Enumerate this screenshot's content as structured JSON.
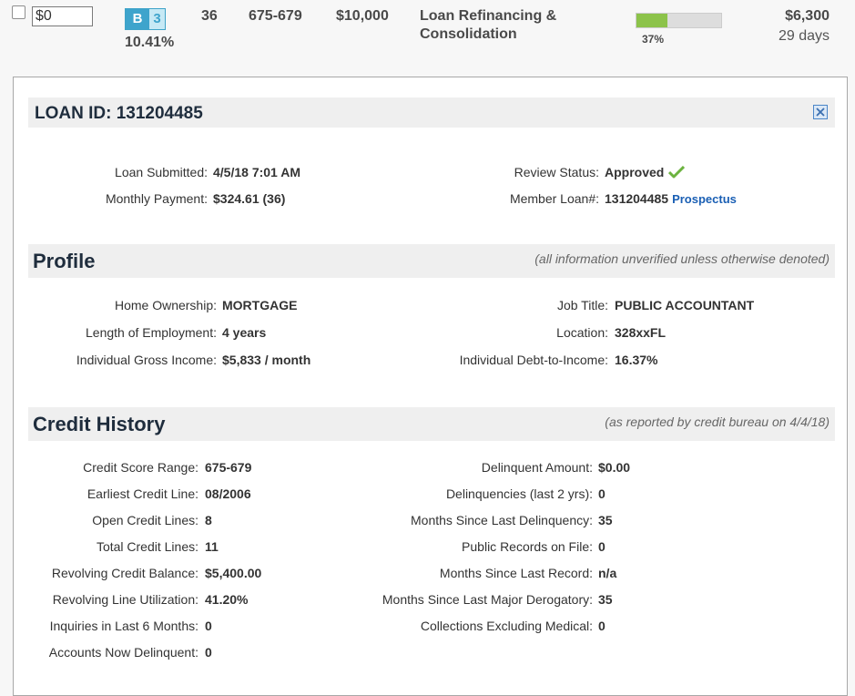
{
  "listing": {
    "invest_amount": "$0",
    "grade_letter": "B",
    "grade_sub": "3",
    "interest_rate": "10.41%",
    "term": "36",
    "fico_range": "675-679",
    "loan_amount": "$10,000",
    "purpose": "Loan Refinancing & Consolidation",
    "funded_percent": 37,
    "funded_percent_label": "37%",
    "amount_remaining": "$6,300",
    "time_left": "29 days"
  },
  "loan": {
    "title": "LOAN ID: 131204485",
    "left": [
      {
        "label": "Loan Submitted:",
        "value": "4/5/18 7:01 AM"
      },
      {
        "label": "Monthly Payment:",
        "value": "$324.61 (36)"
      }
    ],
    "right": [
      {
        "label": "Review Status:",
        "value": "Approved"
      },
      {
        "label": "Member Loan#:",
        "value": "131204485",
        "link": "Prospectus"
      }
    ]
  },
  "profile": {
    "title": "Profile",
    "note": "(all information unverified unless otherwise denoted)",
    "left": [
      {
        "label": "Home Ownership:",
        "value": "MORTGAGE"
      },
      {
        "label": "Length of Employment:",
        "value": "4 years"
      },
      {
        "label": "Individual Gross Income:",
        "value": "$5,833 / month"
      }
    ],
    "right": [
      {
        "label": "Job Title:",
        "value": "PUBLIC ACCOUNTANT"
      },
      {
        "label": "Location:",
        "value": "328xxFL"
      },
      {
        "label": "Individual Debt-to-Income:",
        "value": "16.37%"
      }
    ]
  },
  "credit": {
    "title": "Credit History",
    "note": "(as reported by credit bureau on 4/4/18)",
    "left": [
      {
        "label": "Credit Score Range:",
        "value": "675-679"
      },
      {
        "label": "Earliest Credit Line:",
        "value": "08/2006"
      },
      {
        "label": "Open Credit Lines:",
        "value": "8"
      },
      {
        "label": "Total Credit Lines:",
        "value": "11"
      },
      {
        "label": "Revolving Credit Balance:",
        "value": "$5,400.00"
      },
      {
        "label": "Revolving Line Utilization:",
        "value": "41.20%"
      },
      {
        "label": "Inquiries in Last 6 Months:",
        "value": "0"
      },
      {
        "label": "Accounts Now Delinquent:",
        "value": "0"
      }
    ],
    "right": [
      {
        "label": "Delinquent Amount:",
        "value": "$0.00"
      },
      {
        "label": "Delinquencies (last 2 yrs):",
        "value": "0"
      },
      {
        "label": "Months Since Last Delinquency:",
        "value": "35"
      },
      {
        "label": "Public Records on File:",
        "value": "0"
      },
      {
        "label": "Months Since Last Record:",
        "value": "n/a"
      },
      {
        "label": "Months Since Last Major Derogatory:",
        "value": "35"
      },
      {
        "label": "Collections Excluding Medical:",
        "value": "0"
      }
    ]
  },
  "icons": {
    "close": "close-icon",
    "check": "checkmark-icon"
  },
  "colors": {
    "grade": "#3ea4cc",
    "progress": "#8cc34a",
    "link": "#1a5fb4",
    "check": "#6cb33f"
  }
}
